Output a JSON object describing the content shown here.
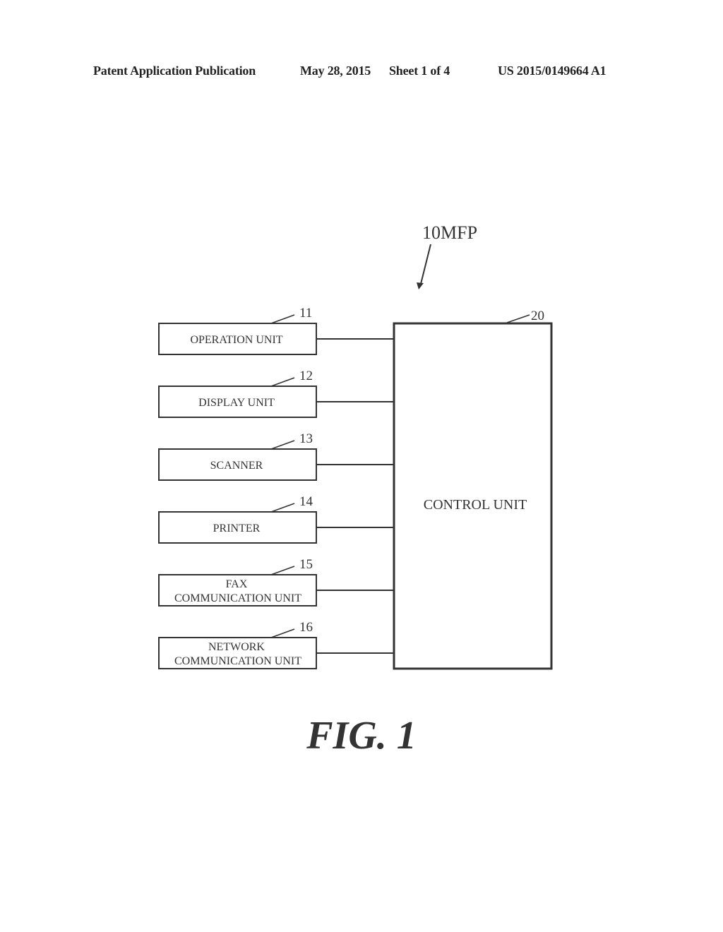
{
  "header": {
    "left": "Patent Application Publication",
    "date": "May 28, 2015",
    "sheet": "Sheet 1 of 4",
    "number": "US 2015/0149664 A1"
  },
  "diagram": {
    "system_ref": "10MFP",
    "control": {
      "ref": "20",
      "label": "CONTROL UNIT"
    },
    "units": [
      {
        "ref": "11",
        "lines": [
          "OPERATION UNIT"
        ]
      },
      {
        "ref": "12",
        "lines": [
          "DISPLAY UNIT"
        ]
      },
      {
        "ref": "13",
        "lines": [
          "SCANNER"
        ]
      },
      {
        "ref": "14",
        "lines": [
          "PRINTER"
        ]
      },
      {
        "ref": "15",
        "lines": [
          "FAX",
          "COMMUNICATION UNIT"
        ]
      },
      {
        "ref": "16",
        "lines": [
          "NETWORK",
          "COMMUNICATION UNIT"
        ]
      }
    ]
  },
  "figure_caption": "FIG. 1"
}
